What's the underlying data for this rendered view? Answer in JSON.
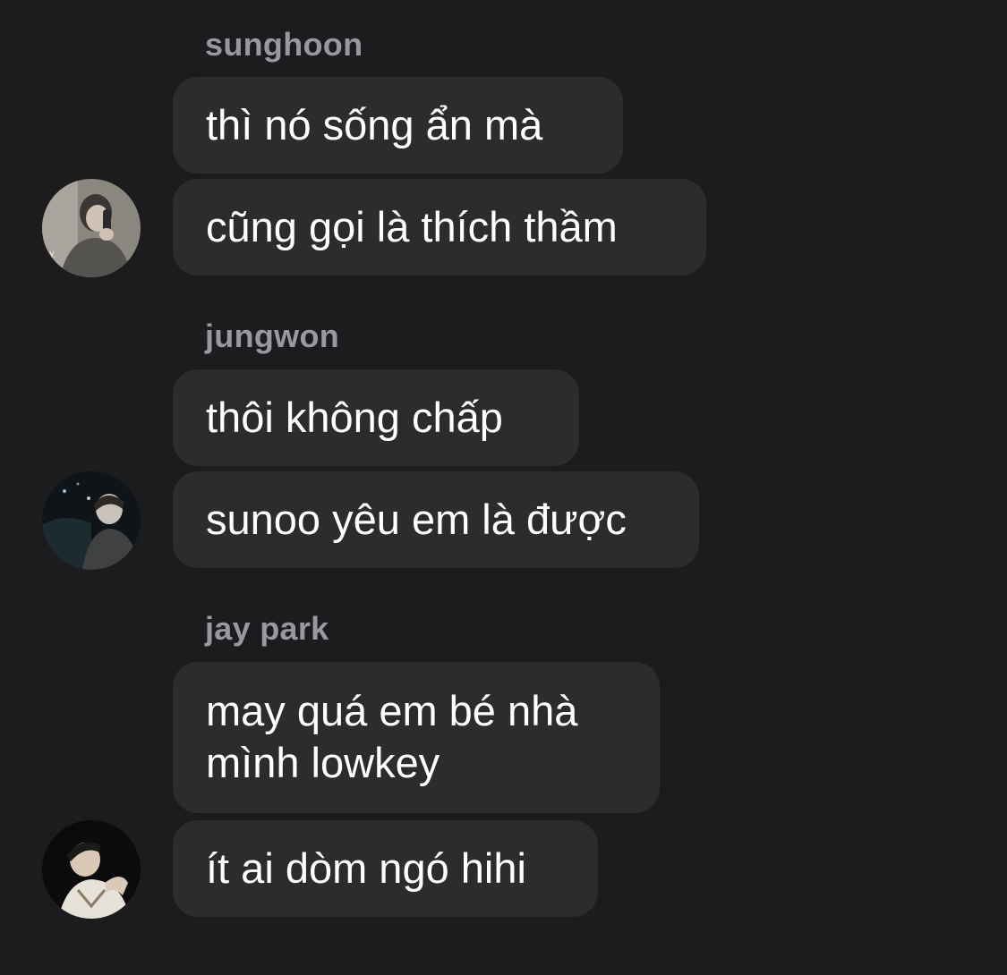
{
  "groups": [
    {
      "sender": "sunghoon",
      "avatar_icon": "avatar-photo-sunghoon",
      "messages": [
        "thì nó sống ẩn mà",
        "cũng gọi là thích thầm"
      ]
    },
    {
      "sender": "jungwon",
      "avatar_icon": "avatar-photo-jungwon",
      "messages": [
        "thôi không chấp",
        "sunoo yêu em là được"
      ]
    },
    {
      "sender": "jay park",
      "avatar_icon": "avatar-photo-jay-park",
      "messages": [
        "may quá em bé nhà mình lowkey",
        "ít ai dòm ngó hihi"
      ]
    }
  ],
  "colors": {
    "background": "#1c1c1e",
    "bubble": "#2c2c2e",
    "sender_name": "#98989f",
    "message_text": "#ffffff"
  }
}
